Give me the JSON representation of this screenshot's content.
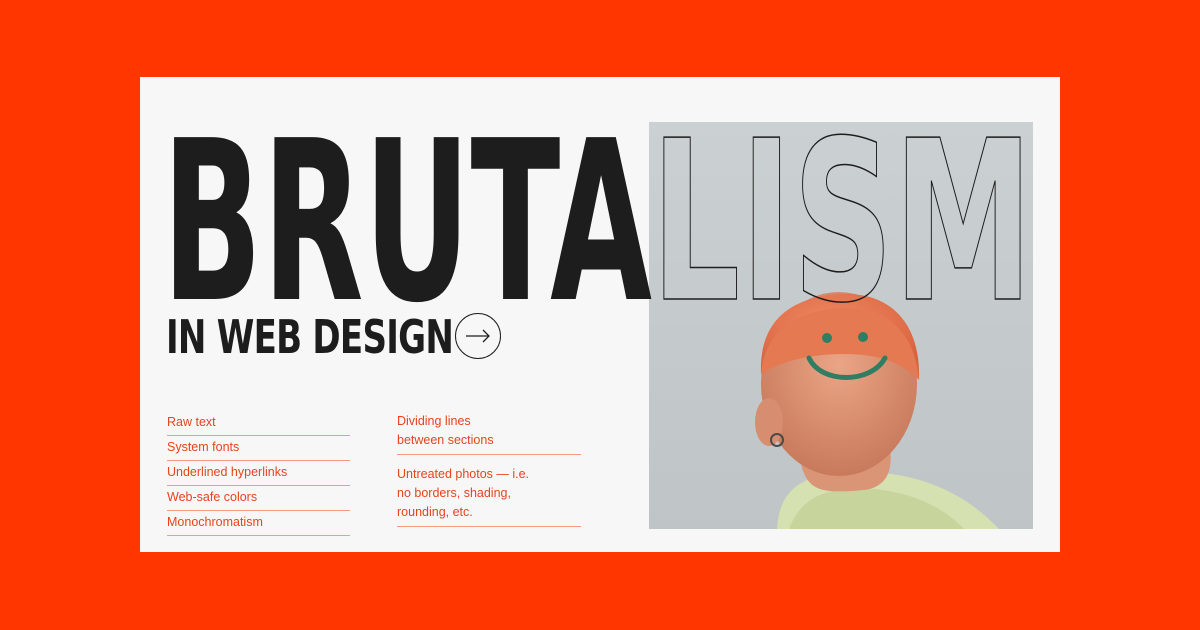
{
  "headline": {
    "solid_part": "BRUTA",
    "outline_part": "LISM",
    "subtitle": "IN WEB DESIGN"
  },
  "icons": {
    "arrow": "arrow-right-icon"
  },
  "features_left": [
    "Raw text",
    "System fonts",
    "Underlined hyperlinks",
    "Web-safe colors",
    "Monochromatism"
  ],
  "features_right": [
    {
      "lines": [
        "Dividing lines",
        "between sections"
      ]
    },
    {
      "lines": [
        "Untreated photos — i.e.",
        "no borders, shading,",
        "rounding, etc."
      ]
    }
  ],
  "colors": {
    "background": "#ff3600",
    "card": "#f7f7f7",
    "text_dark": "#1d1d1d",
    "accent_text": "#e8431d",
    "accent_line": "#f19c83"
  }
}
